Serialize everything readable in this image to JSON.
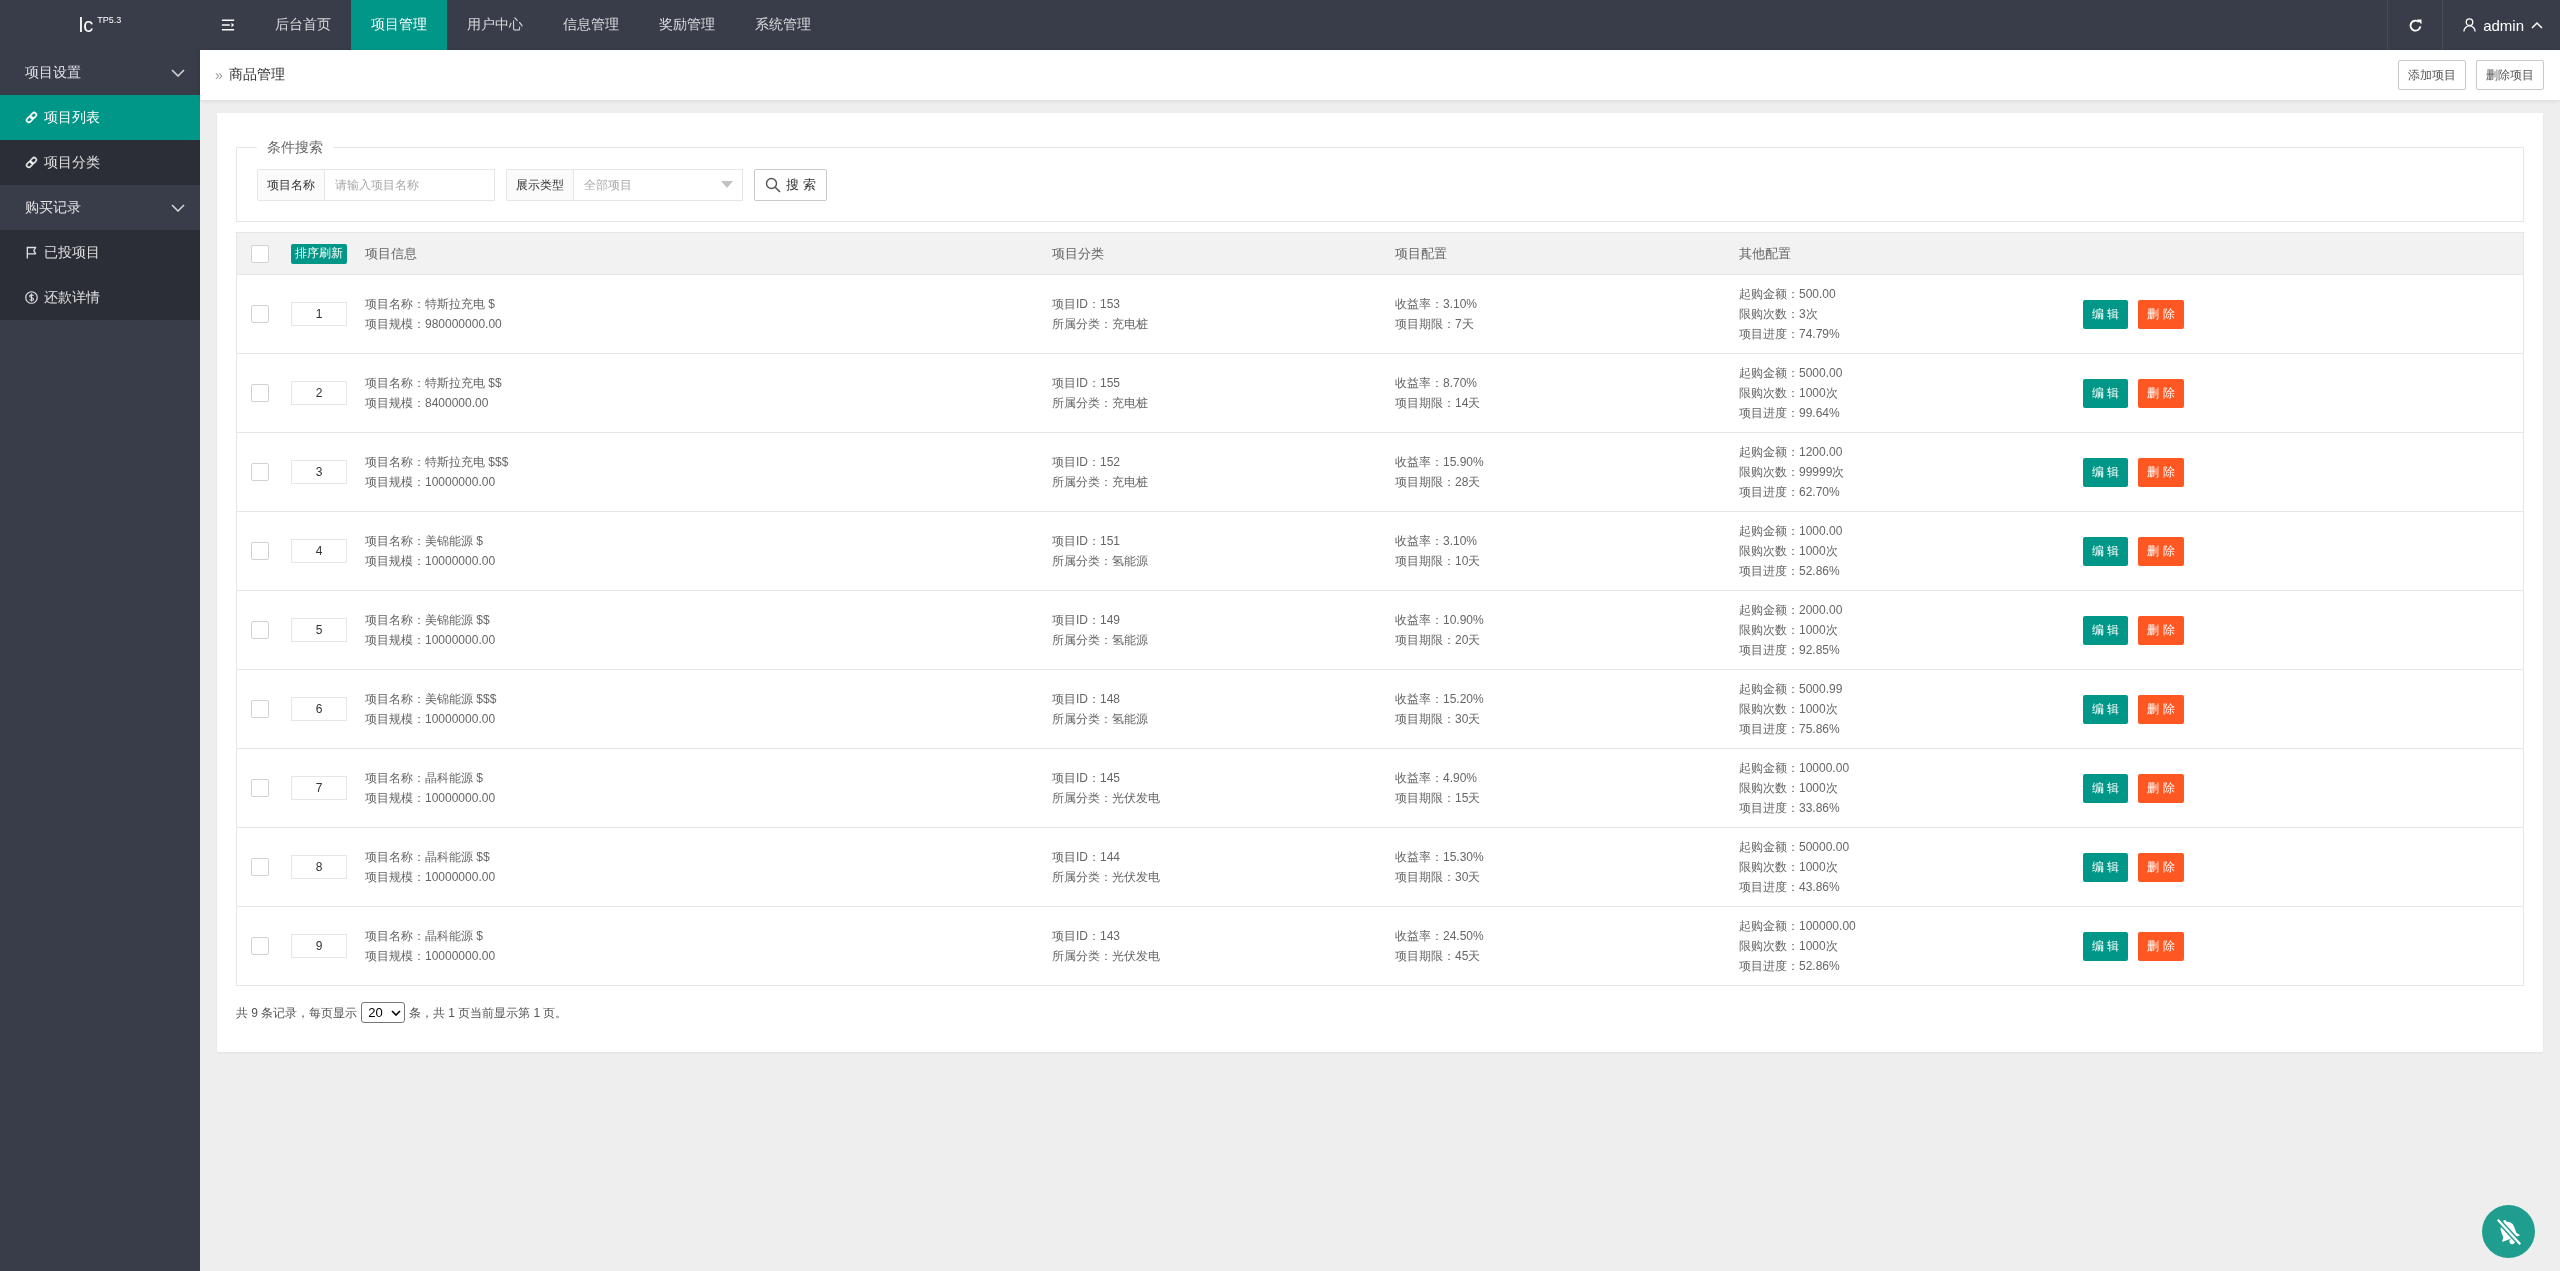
{
  "header": {
    "logo": "lc$^{TP5.3}$",
    "nav": [
      {
        "label": "后台首页",
        "selected": false
      },
      {
        "label": "项目管理",
        "selected": true
      },
      {
        "label": "用户中心",
        "selected": false
      },
      {
        "label": "信息管理",
        "selected": false
      },
      {
        "label": "奖励管理",
        "selected": false
      },
      {
        "label": "系统管理",
        "selected": false
      }
    ],
    "user": "admin"
  },
  "sidebar": {
    "groups": [
      {
        "label": "项目设置",
        "expanded": true,
        "items": [
          {
            "label": "项目列表",
            "selected": true
          },
          {
            "label": "项目分类",
            "selected": false
          }
        ]
      },
      {
        "label": "购买记录",
        "expanded": true,
        "items": [
          {
            "label": "已投项目",
            "selected": false
          },
          {
            "label": "还款详情",
            "selected": false
          }
        ]
      }
    ]
  },
  "breadcrumb": {
    "separator": "»",
    "current": "商品管理",
    "buttons": [
      "添加项目",
      "删除项目"
    ]
  },
  "search": {
    "legend": "条件搜索",
    "fields": [
      {
        "kind": "input",
        "label": "项目名称",
        "placeholder": "请输入项目名称"
      },
      {
        "kind": "select",
        "label": "展示类型",
        "placeholder": "全部项目"
      }
    ],
    "button": "搜 索"
  },
  "table": {
    "header_checked": false,
    "sort_button": "排序刷新",
    "columns": [
      "项目信息",
      "项目分类",
      "项目配置",
      "其他配置"
    ],
    "rows": [
      {
        "checked": false,
        "order": "1",
        "info": [
          "项目名称：特斯拉充电 $",
          "项目规模：980000000.00"
        ],
        "category": [
          "项目ID：153",
          "所属分类：充电桩"
        ],
        "config": [
          "收益率：3.10%",
          "项目期限：7天"
        ],
        "other": [
          "起购金额：500.00",
          "限购次数：3次",
          "项目进度：74.79%"
        ],
        "actions": [
          {
            "kind": "edit",
            "label": "编 辑"
          },
          {
            "kind": "delete",
            "label": "删 除"
          }
        ]
      },
      {
        "checked": false,
        "order": "2",
        "info": [
          "项目名称：特斯拉充电 $$",
          "项目规模：8400000.00"
        ],
        "category": [
          "项目ID：155",
          "所属分类：充电桩"
        ],
        "config": [
          "收益率：8.70%",
          "项目期限：14天"
        ],
        "other": [
          "起购金额：5000.00",
          "限购次数：1000次",
          "项目进度：99.64%"
        ],
        "actions": [
          {
            "kind": "edit",
            "label": "编 辑"
          },
          {
            "kind": "delete",
            "label": "删 除"
          }
        ]
      },
      {
        "checked": false,
        "order": "3",
        "info": [
          "项目名称：特斯拉充电 $$$",
          "项目规模：10000000.00"
        ],
        "category": [
          "项目ID：152",
          "所属分类：充电桩"
        ],
        "config": [
          "收益率：15.90%",
          "项目期限：28天"
        ],
        "other": [
          "起购金额：1200.00",
          "限购次数：99999次",
          "项目进度：62.70%"
        ],
        "actions": [
          {
            "kind": "edit",
            "label": "编 辑"
          },
          {
            "kind": "delete",
            "label": "删 除"
          }
        ]
      },
      {
        "checked": false,
        "order": "4",
        "info": [
          "项目名称：美锦能源 $",
          "项目规模：10000000.00"
        ],
        "category": [
          "项目ID：151",
          "所属分类：氢能源"
        ],
        "config": [
          "收益率：3.10%",
          "项目期限：10天"
        ],
        "other": [
          "起购金额：1000.00",
          "限购次数：1000次",
          "项目进度：52.86%"
        ],
        "actions": [
          {
            "kind": "edit",
            "label": "编 辑"
          },
          {
            "kind": "delete",
            "label": "删 除"
          }
        ]
      },
      {
        "checked": false,
        "order": "5",
        "info": [
          "项目名称：美锦能源 $$",
          "项目规模：10000000.00"
        ],
        "category": [
          "项目ID：149",
          "所属分类：氢能源"
        ],
        "config": [
          "收益率：10.90%",
          "项目期限：20天"
        ],
        "other": [
          "起购金额：2000.00",
          "限购次数：1000次",
          "项目进度：92.85%"
        ],
        "actions": [
          {
            "kind": "edit",
            "label": "编 辑"
          },
          {
            "kind": "delete",
            "label": "删 除"
          }
        ]
      },
      {
        "checked": false,
        "order": "6",
        "info": [
          "项目名称：美锦能源 $$$",
          "项目规模：10000000.00"
        ],
        "category": [
          "项目ID：148",
          "所属分类：氢能源"
        ],
        "config": [
          "收益率：15.20%",
          "项目期限：30天"
        ],
        "other": [
          "起购金额：5000.99",
          "限购次数：1000次",
          "项目进度：75.86%"
        ],
        "actions": [
          {
            "kind": "edit",
            "label": "编 辑"
          },
          {
            "kind": "delete",
            "label": "删 除"
          }
        ]
      },
      {
        "checked": false,
        "order": "7",
        "info": [
          "项目名称：晶科能源 $",
          "项目规模：10000000.00"
        ],
        "category": [
          "项目ID：145",
          "所属分类：光伏发电"
        ],
        "config": [
          "收益率：4.90%",
          "项目期限：15天"
        ],
        "other": [
          "起购金额：10000.00",
          "限购次数：1000次",
          "项目进度：33.86%"
        ],
        "actions": [
          {
            "kind": "edit",
            "label": "编 辑"
          },
          {
            "kind": "delete",
            "label": "删 除"
          }
        ]
      },
      {
        "checked": false,
        "order": "8",
        "info": [
          "项目名称：晶科能源 $$",
          "项目规模：10000000.00"
        ],
        "category": [
          "项目ID：144",
          "所属分类：光伏发电"
        ],
        "config": [
          "收益率：15.30%",
          "项目期限：30天"
        ],
        "other": [
          "起购金额：50000.00",
          "限购次数：1000次",
          "项目进度：43.86%"
        ],
        "actions": [
          {
            "kind": "edit",
            "label": "编 辑"
          },
          {
            "kind": "delete",
            "label": "删 除"
          }
        ]
      },
      {
        "checked": false,
        "order": "9",
        "info": [
          "项目名称：晶科能源 $",
          "项目规模：10000000.00"
        ],
        "category": [
          "项目ID：143",
          "所属分类：光伏发电"
        ],
        "config": [
          "收益率：24.50%",
          "项目期限：45天"
        ],
        "other": [
          "起购金额：100000.00",
          "限购次数：1000次",
          "项目进度：52.86%"
        ],
        "actions": [
          {
            "kind": "edit",
            "label": "编 辑"
          },
          {
            "kind": "delete",
            "label": "删 除"
          }
        ]
      }
    ]
  },
  "pagination": {
    "before": "共 9 条记录，每页显示",
    "page_size": "20",
    "after": "条，共 1 页当前显示第 1 页。"
  }
}
